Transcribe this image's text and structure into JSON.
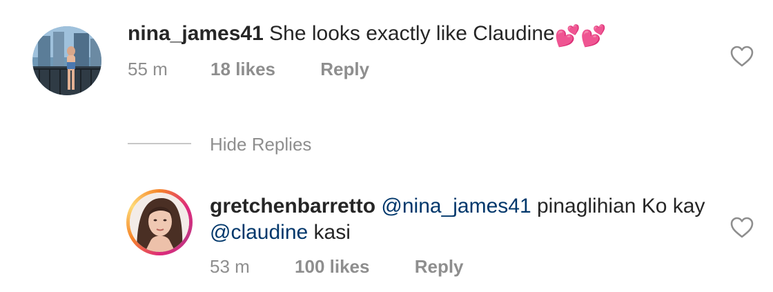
{
  "comments": [
    {
      "username": "nina_james41",
      "text": "She looks  exactly like Claudine",
      "emoji": "💕💕",
      "time": "55 m",
      "likes": "18 likes",
      "reply_label": "Reply"
    },
    {
      "username": "gretchenbarretto",
      "mention1": "@nina_james41",
      "text_mid": " pinaglihian Ko kay ",
      "mention2": "@claudine",
      "text_end": " kasi",
      "time": "53 m",
      "likes": "100 likes",
      "reply_label": "Reply"
    }
  ],
  "hide_replies_label": "Hide Replies",
  "colors": {
    "text": "#262626",
    "meta": "#8e8e8e",
    "mention": "#00376b",
    "story_ring": [
      "#f58529",
      "#dd2a7b",
      "#c13584",
      "#feda77"
    ]
  },
  "icons": {
    "like": "heart-outline-icon"
  }
}
